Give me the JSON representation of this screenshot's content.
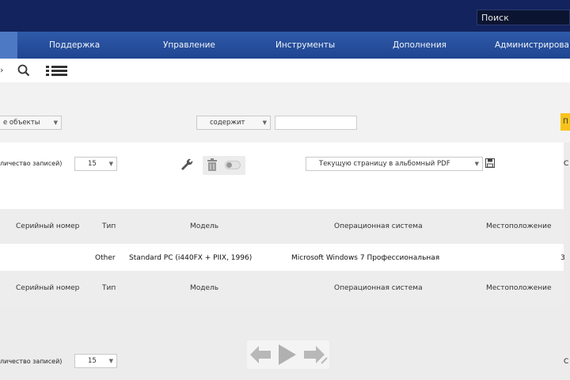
{
  "header": {
    "search_placeholder": "Поиск"
  },
  "nav": [
    {
      "label": "Поддержка"
    },
    {
      "label": "Управление"
    },
    {
      "label": "Инструменты"
    },
    {
      "label": "Дополнения"
    },
    {
      "label": "Администрирова"
    }
  ],
  "toolbar": {
    "search_icon": "magnifier",
    "list_icon": "list"
  },
  "filters": {
    "scope_select": "е объекты",
    "condition_select": "содержит",
    "value": "",
    "go_label": "П"
  },
  "controls": {
    "records_label": "личество записей)",
    "records_value": "15",
    "export_select": "Текущую страницу в альбомный PDF",
    "right_letter": "С"
  },
  "table": {
    "columns": [
      "Серийный номер",
      "Тип",
      "Модель",
      "Операционная система",
      "Местоположение"
    ],
    "rows": [
      [
        "",
        "Other",
        "Standard PC (i440FX + PIIX, 1996)",
        "Microsoft Windows 7 Профессиональная",
        ""
      ]
    ],
    "row_trailing": "3"
  },
  "footer": {
    "records_label": "личество записей)",
    "records_value": "15",
    "right_letter": "С"
  }
}
